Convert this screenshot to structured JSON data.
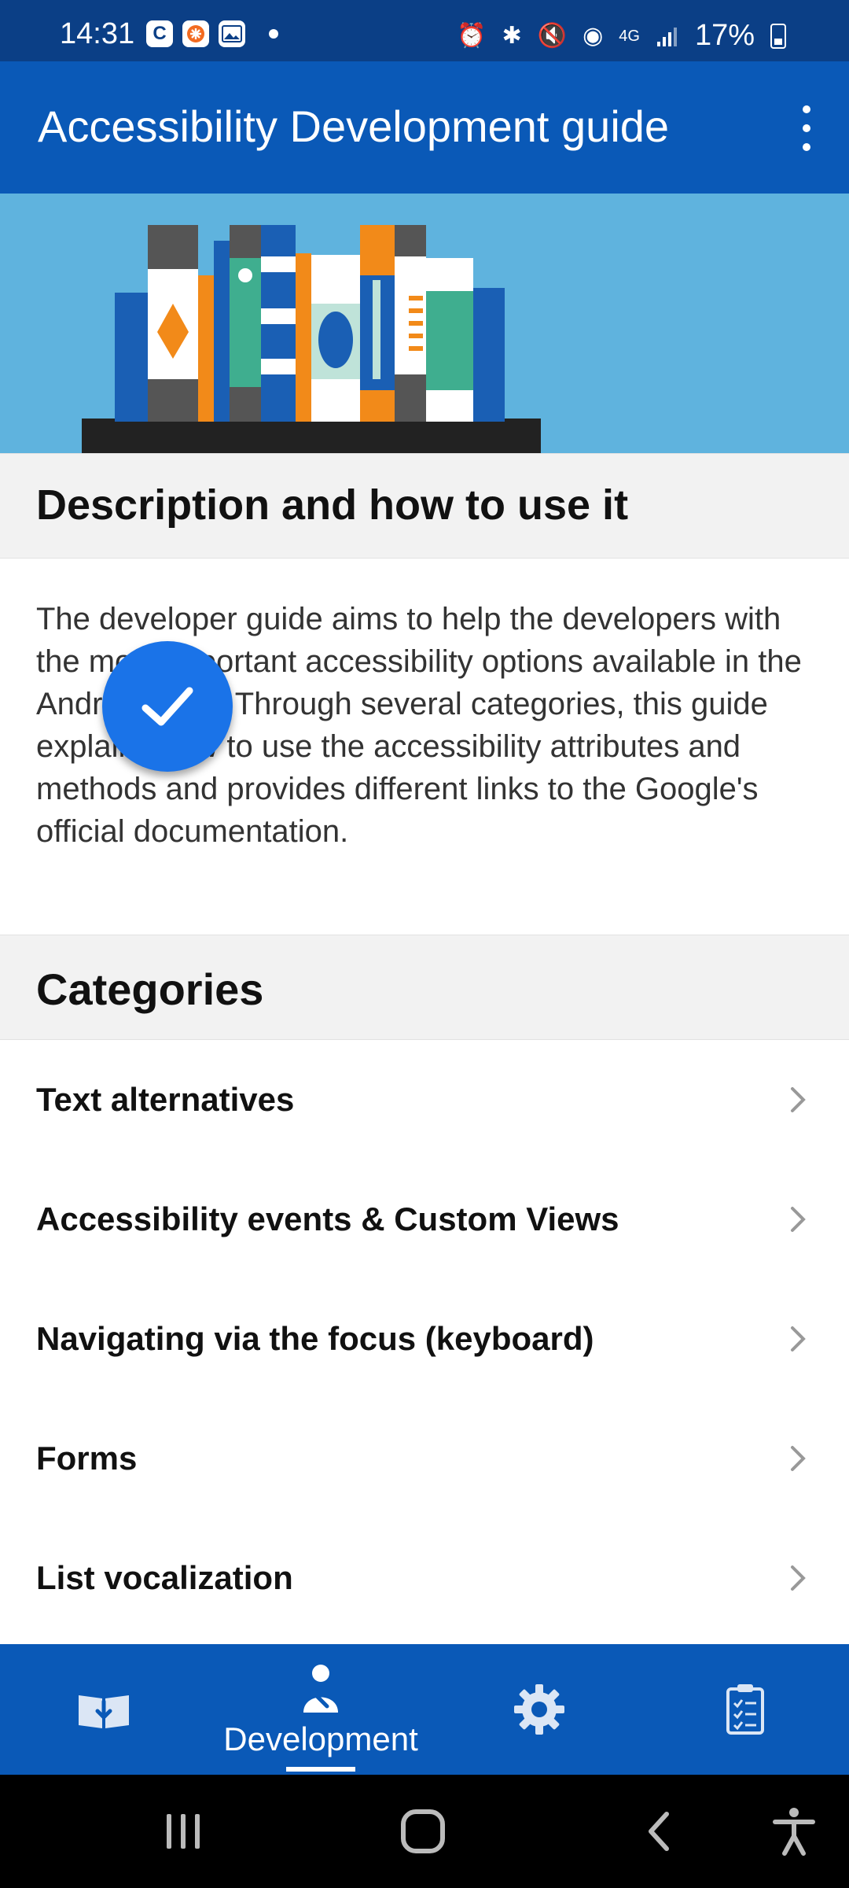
{
  "status_bar": {
    "time": "14:31",
    "left_icons": [
      "c-badge-icon",
      "asterisk-badge-icon",
      "image-icon",
      "notification-dot-icon"
    ],
    "right_icons": [
      "alarm-icon",
      "bluetooth-icon",
      "mute-icon",
      "hotspot-icon",
      "network-4g-icon",
      "signal-icon"
    ],
    "battery": "17%"
  },
  "app_bar": {
    "title": "Accessibility Development guide",
    "menu_icon": "overflow-menu-icon"
  },
  "description_section": {
    "title": "Description and how to use it",
    "body": "The developer guide aims to help the developers with the most important accessibility options available in the Android SDK. Through several categories, this guide explains how to use the accessibility attributes and methods and provides different links to the Google's official documentation."
  },
  "categories_section": {
    "title": "Categories",
    "items": [
      {
        "label": "Text alternatives"
      },
      {
        "label": "Accessibility events & Custom Views"
      },
      {
        "label": "Navigating via the focus (keyboard)"
      },
      {
        "label": "Forms"
      },
      {
        "label": "List vocalization"
      }
    ]
  },
  "bottom_nav": {
    "items": [
      {
        "icon": "guide-download-icon",
        "label": ""
      },
      {
        "icon": "developer-wrench-icon",
        "label": "Development",
        "selected": true
      },
      {
        "icon": "settings-gear-icon",
        "label": ""
      },
      {
        "icon": "checklist-clipboard-icon",
        "label": ""
      }
    ]
  },
  "system_nav": [
    "recents-icon",
    "home-icon",
    "back-icon",
    "accessibility-icon"
  ],
  "colors": {
    "status_bar": "#0b3f86",
    "app_bar": "#0a59b7",
    "hero_background": "#5fb3de",
    "fab": "#1a73e8"
  }
}
